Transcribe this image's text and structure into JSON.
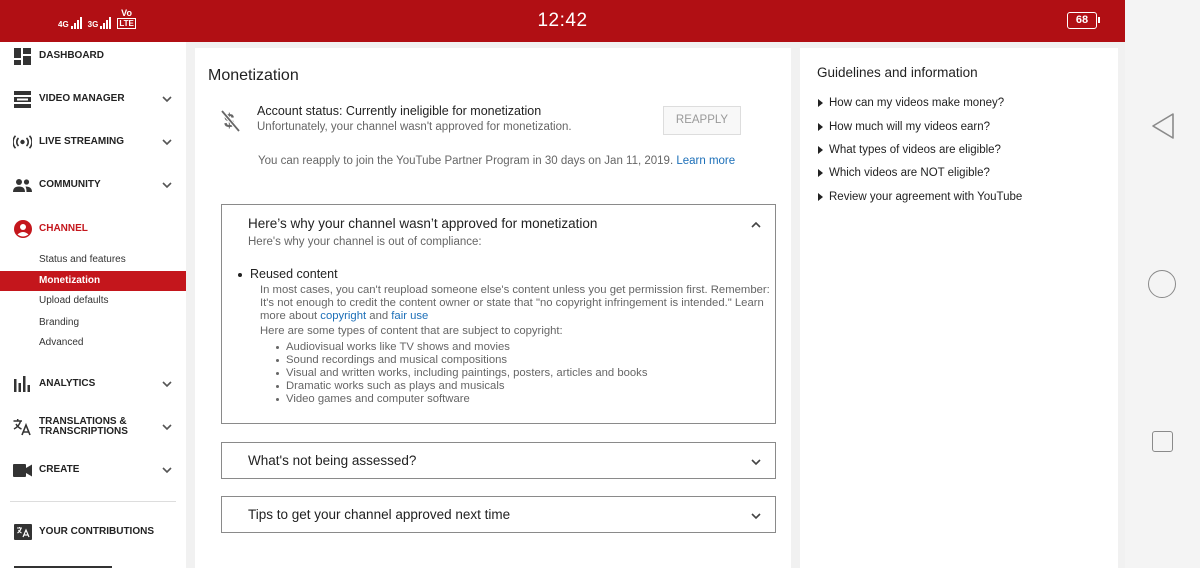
{
  "status_bar": {
    "signal1": "4G",
    "signal2": "3G",
    "volte_top": "Vo",
    "volte_bottom": "LTE",
    "time": "12:42",
    "battery": "68",
    "background": "#b10f14"
  },
  "sidebar": {
    "items": [
      {
        "label": "DASHBOARD",
        "icon": "dashboard-icon"
      },
      {
        "label": "VIDEO MANAGER",
        "icon": "video-manager-icon"
      },
      {
        "label": "LIVE STREAMING",
        "icon": "live-streaming-icon"
      },
      {
        "label": "COMMUNITY",
        "icon": "community-icon"
      },
      {
        "label": "CHANNEL",
        "icon": "channel-icon"
      },
      {
        "label": "ANALYTICS",
        "icon": "analytics-icon"
      },
      {
        "label": "TRANSLATIONS &\nTRANSCRIPTIONS",
        "icon": "translate-icon"
      },
      {
        "label": "CREATE",
        "icon": "create-icon"
      },
      {
        "label": "YOUR CONTRIBUTIONS",
        "icon": "contributions-icon"
      }
    ],
    "channel_subitems": [
      "Status and features",
      "Monetization",
      "Upload defaults",
      "Branding",
      "Advanced"
    ],
    "active_subitem": "Monetization",
    "accent_color": "#c4161c"
  },
  "main": {
    "title": "Monetization",
    "status_title": "Account status: Currently ineligible for monetization",
    "status_subtitle": "Unfortunately, your channel wasn't approved for monetization.",
    "reapply_label": "REAPPLY",
    "reapply_note": "You can reapply to join the YouTube Partner Program in 30 days on Jan 11, 2019.",
    "learn_more": "Learn more",
    "card1": {
      "title": "Here’s why your channel wasn’t approved for monetization",
      "subtitle": "Here's why your channel is out of compliance:",
      "reason_title": "Reused content",
      "reason_text": "In most cases, you can't reupload someone else's content unless you get permission first. Remember: It's not enough to credit the content owner or state that \"no copyright infringement is intended.\" Learn more about",
      "link_copyright": "copyright",
      "link_and": "and",
      "link_fair_use": "fair use",
      "types_intro": "Here are some types of content that are subject to copyright:",
      "types": [
        "Audiovisual works like TV shows and movies",
        "Sound recordings and musical compositions",
        "Visual and written works, including paintings, posters, articles and books",
        "Dramatic works such as plays and musicals",
        "Video games and computer software"
      ]
    },
    "card2": {
      "title": "What's not being assessed?"
    },
    "card3": {
      "title": "Tips to get your channel approved next time"
    }
  },
  "right": {
    "title": "Guidelines and information",
    "items": [
      "How can my videos make money?",
      "How much will my videos earn?",
      "What types of videos are eligible?",
      "Which videos are NOT eligible?",
      "Review your agreement with YouTube"
    ]
  }
}
